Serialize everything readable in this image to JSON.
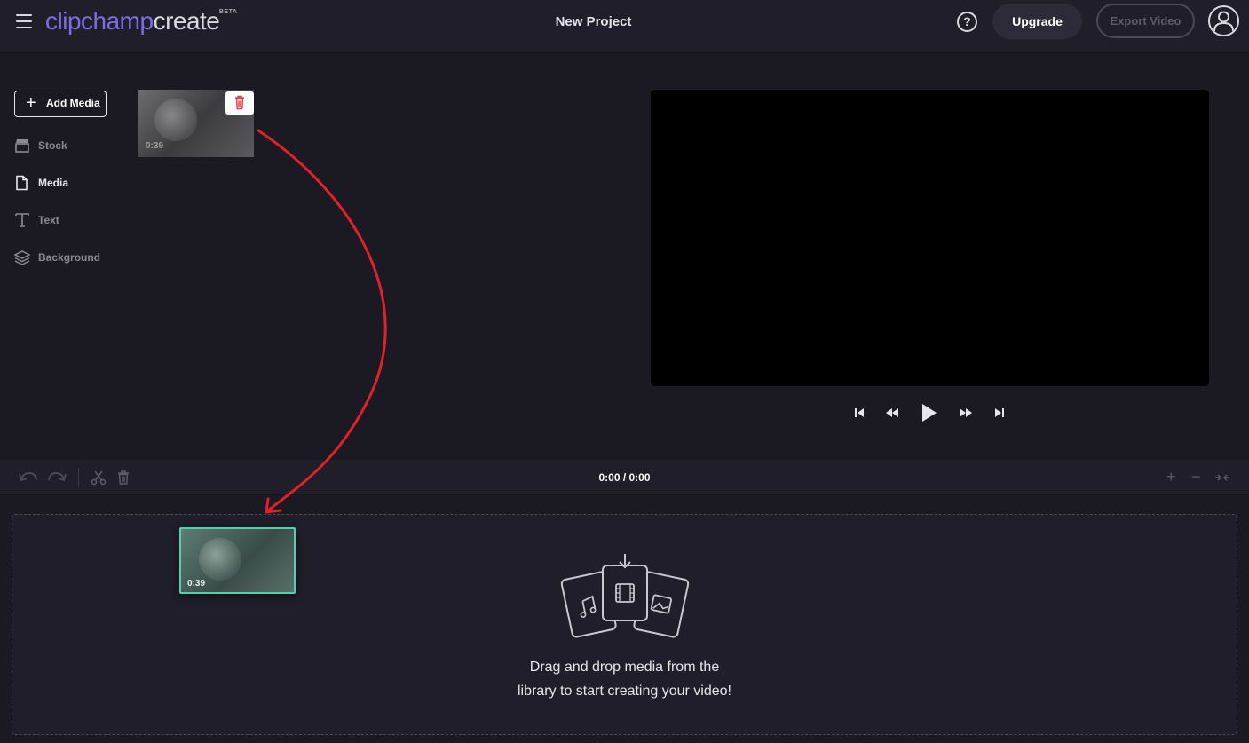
{
  "app": {
    "logo_brand": "clipchamp",
    "logo_product": "create",
    "logo_badge": "BETA",
    "project_title": "New Project",
    "help_label": "?",
    "upgrade_label": "Upgrade",
    "export_label": "Export Video"
  },
  "sidebar": {
    "add_media_label": "Add Media",
    "items": [
      {
        "label": "Stock",
        "icon": "store-icon",
        "active": false
      },
      {
        "label": "Media",
        "icon": "file-icon",
        "active": true
      },
      {
        "label": "Text",
        "icon": "text-icon",
        "active": false
      },
      {
        "label": "Background",
        "icon": "layers-icon",
        "active": false
      }
    ]
  },
  "library": {
    "clip_duration": "0:39"
  },
  "timeline": {
    "timecode": "0:00 / 0:00",
    "dragged_clip_duration": "0:39",
    "drop_hint_line1": "Drag and drop media from the",
    "drop_hint_line2": "library to start creating your video!"
  },
  "colors": {
    "accent": "#7b6fe0",
    "clip_highlight": "#4fd1b0",
    "annotation_arrow": "#e0202a",
    "delete_icon": "#e0404a"
  }
}
